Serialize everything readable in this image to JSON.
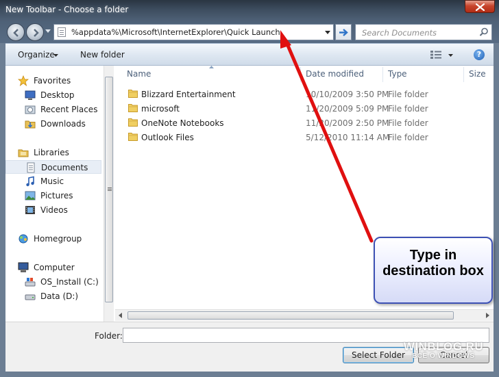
{
  "window": {
    "title": "New Toolbar - Choose a folder"
  },
  "address": {
    "path": "%appdata%\\Microsoft\\InternetExplorer\\Quick Launch"
  },
  "search": {
    "placeholder": "Search Documents"
  },
  "toolbar": {
    "organize_label": "Organize",
    "new_folder_label": "New folder"
  },
  "nav": {
    "items": [
      {
        "label": "Favorites",
        "icon": "star-icon"
      },
      {
        "label": "Desktop",
        "icon": "desktop-icon"
      },
      {
        "label": "Recent Places",
        "icon": "recent-places-icon"
      },
      {
        "label": "Downloads",
        "icon": "downloads-folder-icon"
      },
      {
        "label": "Libraries",
        "icon": "libraries-icon"
      },
      {
        "label": "Documents",
        "icon": "documents-icon",
        "selected": true
      },
      {
        "label": "Music",
        "icon": "music-icon"
      },
      {
        "label": "Pictures",
        "icon": "pictures-icon"
      },
      {
        "label": "Videos",
        "icon": "videos-icon"
      },
      {
        "label": "Homegroup",
        "icon": "homegroup-icon"
      },
      {
        "label": "Computer",
        "icon": "computer-icon"
      },
      {
        "label": "OS_Install (C:)",
        "icon": "drive-c-icon"
      },
      {
        "label": "Data (D:)",
        "icon": "drive-d-icon"
      }
    ]
  },
  "list": {
    "columns": {
      "name": "Name",
      "date": "Date modified",
      "type": "Type",
      "size": "Size"
    },
    "rows": [
      {
        "name": "Blizzard Entertainment",
        "date": "10/10/2009 3:50 PM",
        "type": "File folder"
      },
      {
        "name": "microsoft",
        "date": "11/20/2009 5:09 PM",
        "type": "File folder"
      },
      {
        "name": "OneNote Notebooks",
        "date": "11/20/2009 2:50 PM",
        "type": "File folder"
      },
      {
        "name": "Outlook Files",
        "date": "5/12/2010 11:14 AM",
        "type": "File folder"
      }
    ]
  },
  "bottom": {
    "folder_label": "Folder:",
    "folder_value": "",
    "select_label": "Select Folder",
    "cancel_label": "Cancel"
  },
  "annotation": {
    "callout_text": "Type in destination box",
    "arrow_color": "#e01010"
  },
  "watermark": {
    "main": "WINBLOG.RU",
    "sub": "ВСЁ О WINDOWS"
  },
  "colors": {
    "accent": "#3c50b4",
    "title_bar": "#2a3542",
    "selected_row": "#e8eef6"
  }
}
